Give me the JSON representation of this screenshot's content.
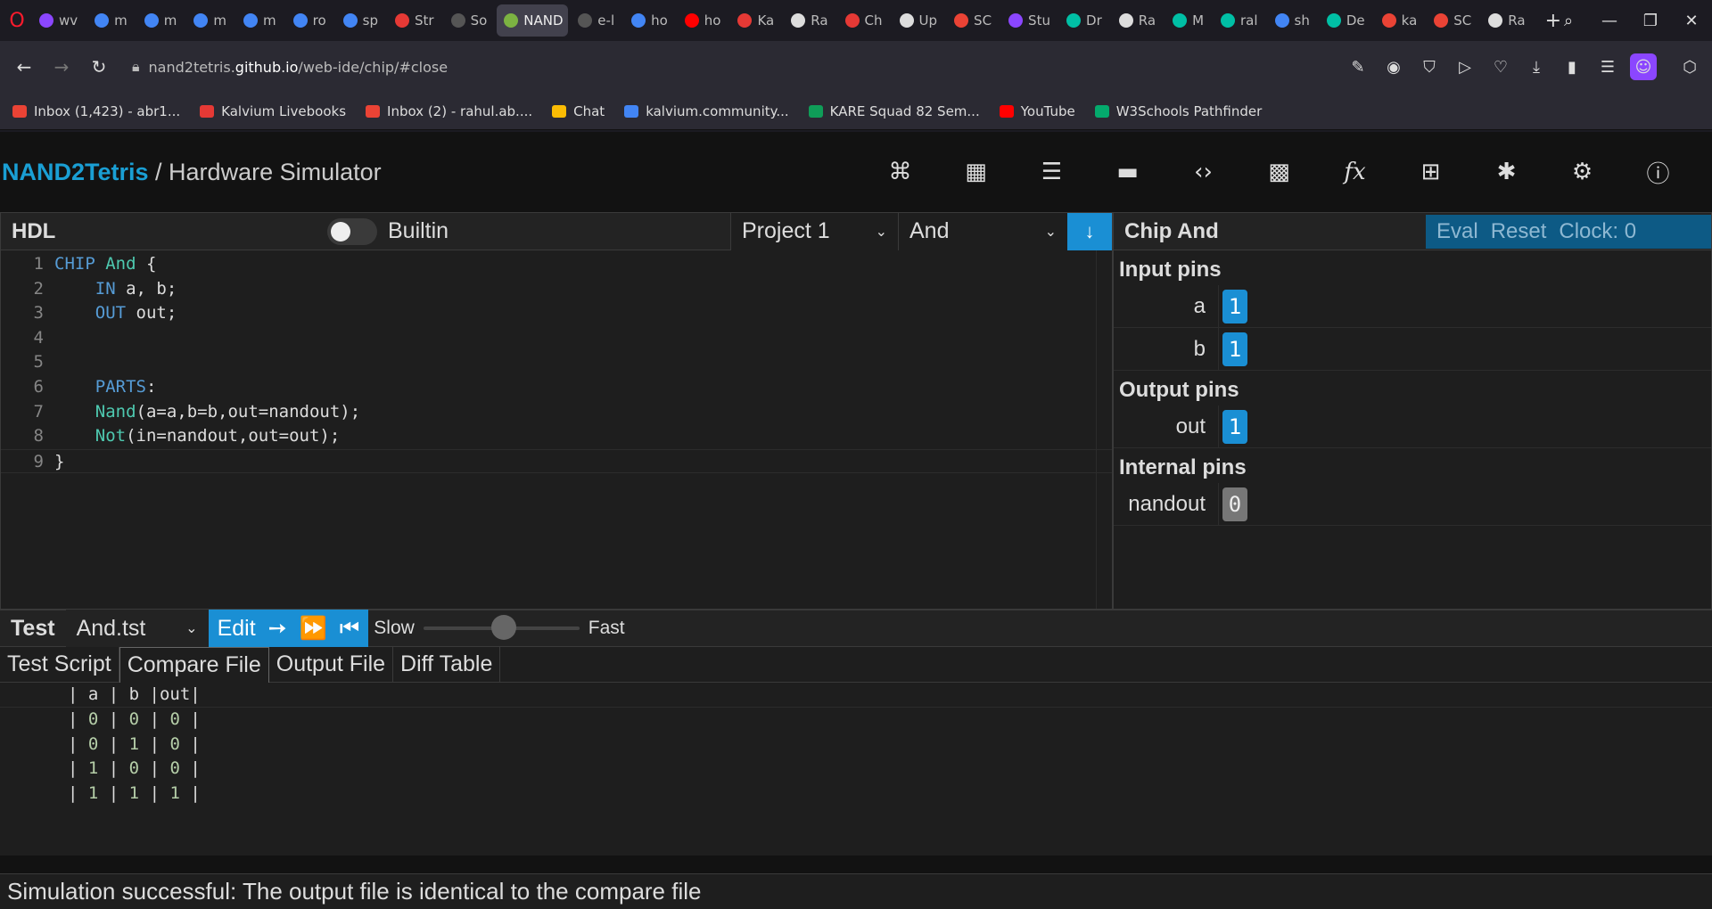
{
  "browser": {
    "tabs": [
      {
        "label": "wv",
        "color": "#8b46ff"
      },
      {
        "label": "m",
        "color": "#4285f4"
      },
      {
        "label": "m",
        "color": "#4285f4"
      },
      {
        "label": "m",
        "color": "#4285f4"
      },
      {
        "label": "m",
        "color": "#4285f4"
      },
      {
        "label": "ro",
        "color": "#4285f4"
      },
      {
        "label": "sp",
        "color": "#4285f4"
      },
      {
        "label": "Str",
        "color": "#e53935"
      },
      {
        "label": "So",
        "color": "#555"
      },
      {
        "label": "NAND",
        "color": "#7cb342",
        "active": true
      },
      {
        "label": "e-l",
        "color": "#555"
      },
      {
        "label": "ho",
        "color": "#4285f4"
      },
      {
        "label": "ho",
        "color": "#ff0000"
      },
      {
        "label": "Ka",
        "color": "#e53935"
      },
      {
        "label": "Ra",
        "color": "#ddd"
      },
      {
        "label": "Ch",
        "color": "#e53935"
      },
      {
        "label": "Up",
        "color": "#ddd"
      },
      {
        "label": "SC",
        "color": "#ea4335"
      },
      {
        "label": "Stu",
        "color": "#8b46ff"
      },
      {
        "label": "Dr",
        "color": "#00bfa5"
      },
      {
        "label": "Ra",
        "color": "#ddd"
      },
      {
        "label": "M",
        "color": "#00bfa5"
      },
      {
        "label": "ral",
        "color": "#00bfa5"
      },
      {
        "label": "sh",
        "color": "#4285f4"
      },
      {
        "label": "De",
        "color": "#00bfa5"
      },
      {
        "label": "ka",
        "color": "#ea4335"
      },
      {
        "label": "SC",
        "color": "#ea4335"
      },
      {
        "label": "Ra",
        "color": "#ddd"
      }
    ],
    "url_prefix": "nand2tetris.",
    "url_host": "github.io",
    "url_path": "/web-ide/chip/#close",
    "bookmarks": [
      {
        "label": "Inbox (1,423) - abr1...",
        "color": "#ea4335"
      },
      {
        "label": "Kalvium Livebooks",
        "color": "#e53935"
      },
      {
        "label": "Inbox (2) - rahul.ab....",
        "color": "#ea4335"
      },
      {
        "label": "Chat",
        "color": "#fbbc04"
      },
      {
        "label": "kalvium.community...",
        "color": "#4285f4"
      },
      {
        "label": "KARE Squad 82 Sem...",
        "color": "#0f9d58"
      },
      {
        "label": "YouTube",
        "color": "#ff0000"
      },
      {
        "label": "W3Schools Pathfinder",
        "color": "#04aa6d"
      }
    ]
  },
  "app": {
    "brand_name": "NAND2Tetris",
    "brand_sep": " / ",
    "brand_page": "Hardware Simulator"
  },
  "hdl": {
    "title": "HDL",
    "builtin_label": "Builtin",
    "project": "Project 1",
    "chip": "And",
    "lines": [
      {
        "n": "1",
        "html": "<span class='kw'>CHIP</span> <span class='fn'>And</span> {"
      },
      {
        "n": "2",
        "html": "    <span class='kw'>IN</span> a, b;"
      },
      {
        "n": "3",
        "html": "    <span class='kw'>OUT</span> out;"
      },
      {
        "n": "4",
        "html": ""
      },
      {
        "n": "5",
        "html": ""
      },
      {
        "n": "6",
        "html": "    <span class='kw'>PARTS</span>:"
      },
      {
        "n": "7",
        "html": "    <span class='fn'>Nand</span>(a=a,b=b,out=nandout);"
      },
      {
        "n": "8",
        "html": "    <span class='fn'>Not</span>(in=nandout,out=out);"
      },
      {
        "n": "9",
        "html": "}"
      }
    ]
  },
  "chip_panel": {
    "title": "Chip And",
    "eval": "Eval",
    "reset": "Reset",
    "clock": "Clock: 0",
    "input_title": "Input pins",
    "output_title": "Output pins",
    "internal_title": "Internal pins",
    "inputs": [
      {
        "name": "a",
        "value": "1"
      },
      {
        "name": "b",
        "value": "1"
      }
    ],
    "outputs": [
      {
        "name": "out",
        "value": "1"
      }
    ],
    "internals": [
      {
        "name": "nandout",
        "value": "0"
      }
    ]
  },
  "test": {
    "title": "Test",
    "file": "And.tst",
    "edit": "Edit",
    "slow": "Slow",
    "fast": "Fast",
    "tabs": [
      "Test Script",
      "Compare File",
      "Output File",
      "Diff Table"
    ],
    "active_tab": 1,
    "header": "| a | b |out|",
    "rows": [
      [
        "0",
        "0",
        "0"
      ],
      [
        "0",
        "1",
        "0"
      ],
      [
        "1",
        "0",
        "0"
      ],
      [
        "1",
        "1",
        "1"
      ]
    ]
  },
  "status": "Simulation successful: The output file is identical to the compare file"
}
